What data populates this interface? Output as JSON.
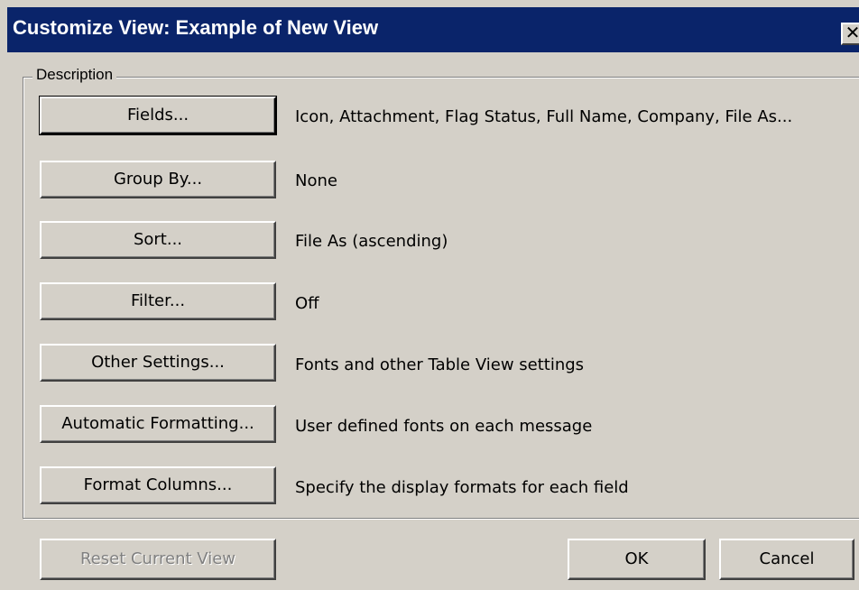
{
  "window": {
    "title": "Customize View: Example of New View",
    "close_glyph": "✕",
    "close_icon": "close-icon"
  },
  "description_group": {
    "label": "Description",
    "rows": [
      {
        "button": "Fields...",
        "value": "Icon, Attachment, Flag Status, Full Name, Company, File As..."
      },
      {
        "button": "Group By...",
        "value": "None"
      },
      {
        "button": "Sort...",
        "value": "File As (ascending)"
      },
      {
        "button": "Filter...",
        "value": "Off"
      },
      {
        "button": "Other Settings...",
        "value": "Fonts and other Table View settings"
      },
      {
        "button": "Automatic Formatting...",
        "value": "User defined fonts on each message"
      },
      {
        "button": "Format Columns...",
        "value": "Specify the display formats for each field"
      }
    ]
  },
  "footer": {
    "reset_label": "Reset Current View",
    "ok_label": "OK",
    "cancel_label": "Cancel"
  },
  "colors": {
    "titlebar": "#0a246a",
    "face": "#d4d0c8",
    "disabled_text": "#808080"
  }
}
